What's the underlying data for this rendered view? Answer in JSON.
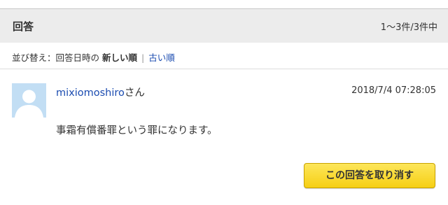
{
  "header": {
    "title": "回答",
    "count": "1～3件/3件中"
  },
  "sort": {
    "label": "並び替え：回答日時の",
    "current": "新しい順",
    "separator": "|",
    "alternative": "古い順"
  },
  "answer": {
    "avatar_icon": "default-user-icon",
    "username": "mixiomoshiro",
    "honorific": "さん",
    "timestamp": "2018/7/4  07:28:05",
    "body": "事霜有償番罪という罪になります。",
    "cancel_label": "この回答を取り消す"
  },
  "colors": {
    "header_bg": "#ececec",
    "link": "#1a4bb0",
    "button": "#f6cf14",
    "avatar_bg": "#c2def4"
  }
}
